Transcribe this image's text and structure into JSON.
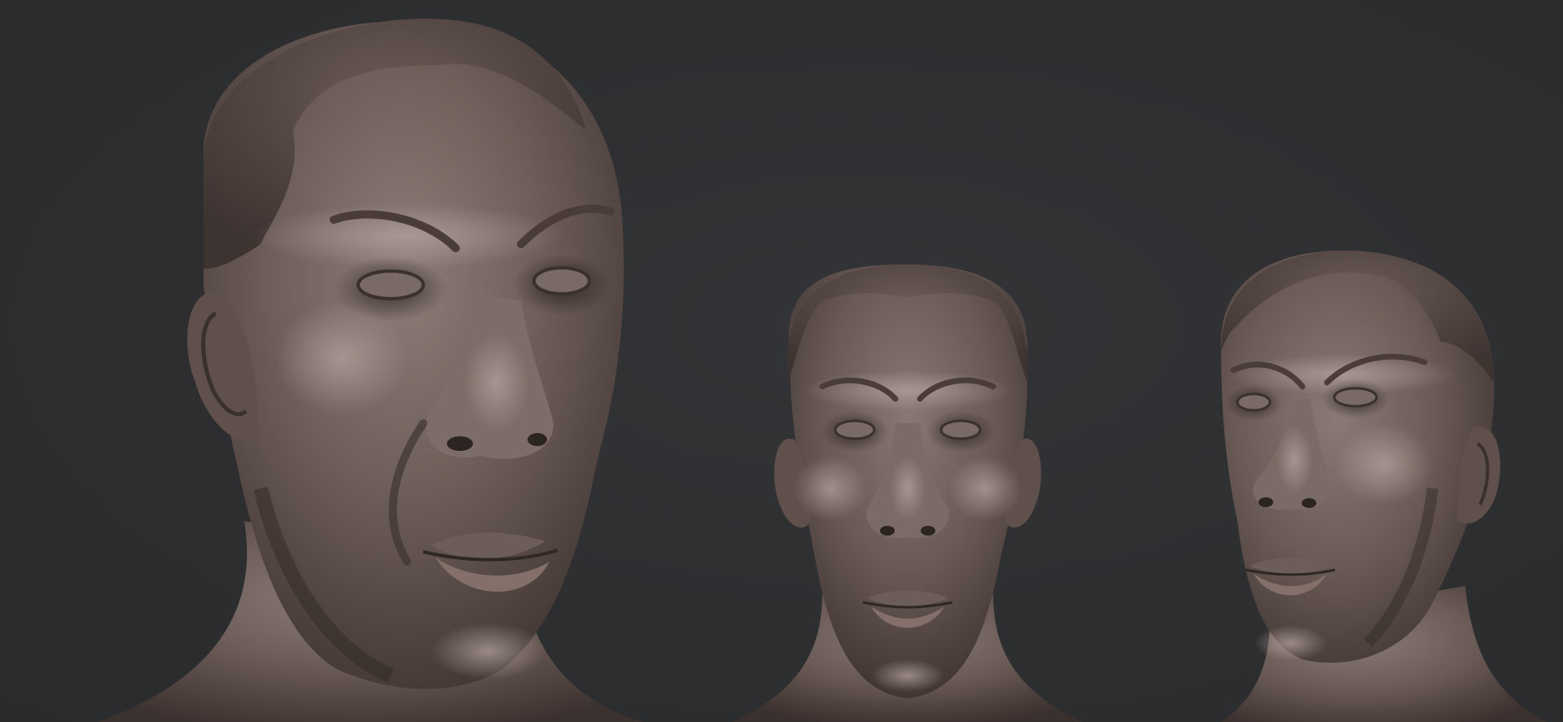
{
  "scene": {
    "background_color": "#2e2f31",
    "material_color": "#6e5d58",
    "highlight_color": "#9a8a85",
    "shadow_color": "#3a302d",
    "busts": [
      {
        "view": "three-quarter-left-closeup"
      },
      {
        "view": "front"
      },
      {
        "view": "three-quarter-right"
      }
    ]
  }
}
